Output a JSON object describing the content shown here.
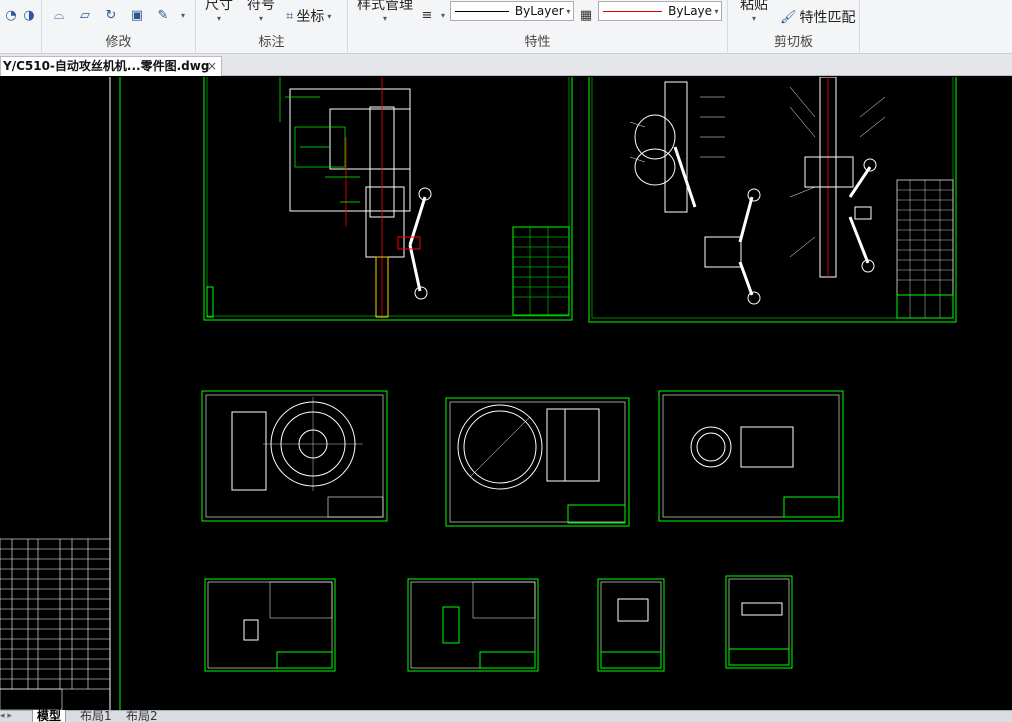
{
  "ribbon": {
    "modify": {
      "title": "修改"
    },
    "annotate": {
      "title": "标注",
      "dimension_label": "尺寸",
      "symbol_label": "符号",
      "coordinate_label": "坐标"
    },
    "properties": {
      "title": "特性",
      "style_manager_label": "样式管理",
      "linetype_value": "ByLayer",
      "color_value": "ByLaye"
    },
    "clipboard": {
      "title": "剪切板",
      "paste_label": "粘贴",
      "match_properties_label": "特性匹配"
    }
  },
  "document_tab": {
    "title": "Y/C510-自动攻丝机机...零件图.dwg",
    "close_glyph": "×"
  },
  "layout_tabs": [
    {
      "label": "模型",
      "active": true
    },
    {
      "label": "布局1",
      "active": false
    },
    {
      "label": "布局2",
      "active": false
    }
  ],
  "colors": {
    "ribbon_bg": "#f4f5f7",
    "canvas_bg": "#000000",
    "frame_green": "#00ff00",
    "line_white": "#ffffff",
    "line_red": "#ff0000",
    "accent_blue": "#2b5797"
  },
  "icons": [
    "curve-tool-icon",
    "page-tool-icon",
    "rotate-icon",
    "image-tool-icon",
    "edit-tool-icon",
    "coordinate-icon",
    "lineweight-icon",
    "paste-icon",
    "match-properties-icon",
    "close-icon"
  ]
}
